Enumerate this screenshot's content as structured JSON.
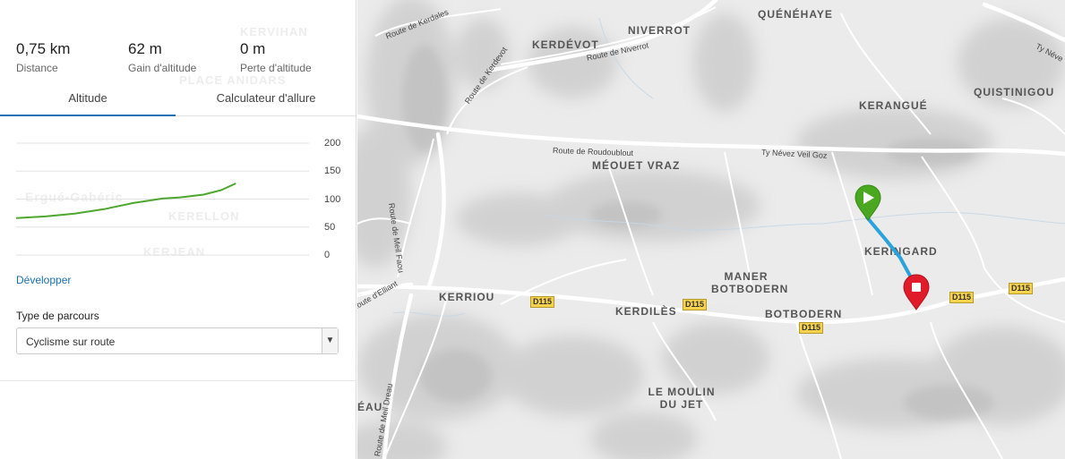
{
  "stats": [
    {
      "value": "0,75 km",
      "label": "Distance"
    },
    {
      "value": "62 m",
      "label": "Gain d'altitude"
    },
    {
      "value": "0 m",
      "label": "Perte d'altitude"
    }
  ],
  "tabs": [
    {
      "label": "Altitude",
      "active": true
    },
    {
      "label": "Calculateur d'allure",
      "active": false
    }
  ],
  "chart_data": {
    "type": "line",
    "ylim": [
      0,
      200
    ],
    "yticks": [
      "200",
      "150",
      "100",
      "50",
      "0"
    ],
    "grid": true,
    "series": [
      {
        "color": "#4ea72e",
        "x": [
          0,
          0.1,
          0.2,
          0.3,
          0.4,
          0.5,
          0.56,
          0.64,
          0.7,
          0.75
        ],
        "y": [
          66,
          69,
          74,
          82,
          93,
          101,
          103,
          108,
          116,
          128
        ]
      }
    ]
  },
  "expand_label": "Développer",
  "route_type": {
    "label": "Type de parcours",
    "selected": "Cyclisme sur route"
  },
  "map": {
    "places": [
      "QUÉNÉHAYE",
      "KERDÉVOT",
      "NIVERROT",
      "QUISTINIGOU",
      "KERANGUÉ",
      "MÉOUET VRAZ",
      "KERINGARD",
      "MANER BOTBODERN",
      "KERRIOU",
      "KERDILÈS",
      "BOTBODERN",
      "LE MOULIN DU JET",
      "ÉAU"
    ],
    "roads": [
      "Route de Kerdales",
      "Route de Niverrot",
      "Route de Kerdevot",
      "Route de Roudoublout",
      "Ty Névez Veil Goz",
      "Route de Meil Faou",
      "Route d'Elliant",
      "Route de Meil Dreau",
      "Ty Néve"
    ],
    "shields": [
      "D115",
      "D115",
      "D115",
      "D115",
      "D115"
    ],
    "start_icon": "play-icon",
    "end_icon": "stop-icon",
    "route_color": "#2aa3dd",
    "start_color": "#4aa820",
    "end_color": "#e01b2a"
  }
}
